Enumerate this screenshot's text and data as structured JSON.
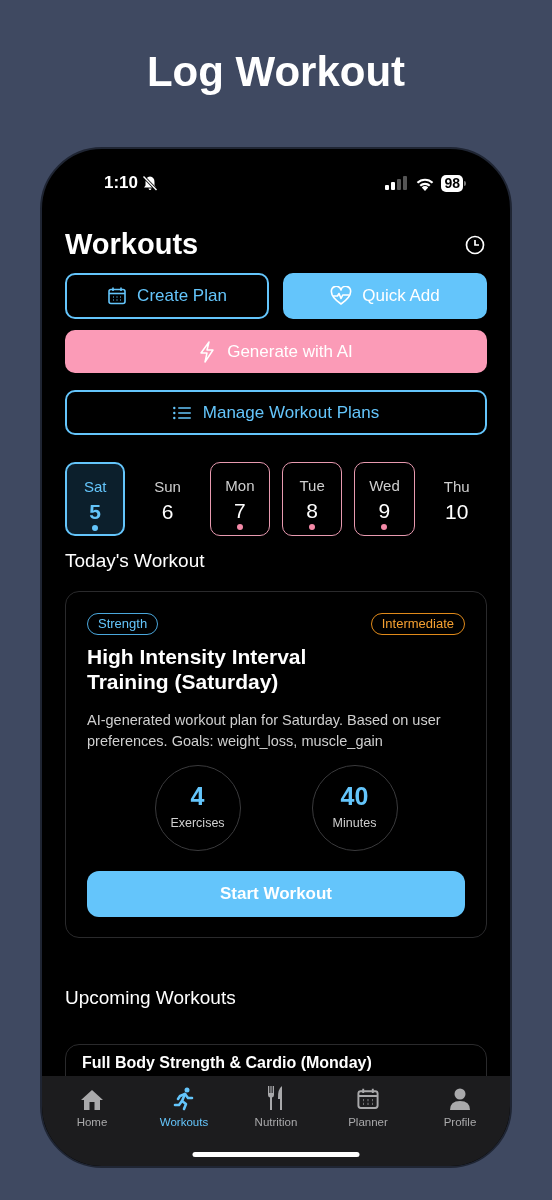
{
  "page_title": "Log Workout",
  "status_bar": {
    "time": "1:10",
    "battery": "98"
  },
  "header": {
    "title": "Workouts"
  },
  "actions": [
    {
      "label": "Create Plan",
      "kind": "outline"
    },
    {
      "label": "Quick Add",
      "kind": "filled"
    }
  ],
  "generate_button": {
    "label": "Generate with AI"
  },
  "manage_button": {
    "label": "Manage Workout Plans"
  },
  "days": [
    {
      "weekday": "Sat",
      "date": "5",
      "selected": true,
      "has_workout": true
    },
    {
      "weekday": "Sun",
      "date": "6",
      "selected": false,
      "has_workout": false
    },
    {
      "weekday": "Mon",
      "date": "7",
      "selected": false,
      "has_workout": true
    },
    {
      "weekday": "Tue",
      "date": "8",
      "selected": false,
      "has_workout": true
    },
    {
      "weekday": "Wed",
      "date": "9",
      "selected": false,
      "has_workout": true
    },
    {
      "weekday": "Thu",
      "date": "10",
      "selected": false,
      "has_workout": false
    }
  ],
  "today": {
    "heading": "Today's Workout",
    "category": "Strength",
    "level_badge": "Intermediate",
    "title": "High Intensity Interval Training (Saturday)",
    "description": "AI-generated workout plan for Saturday. Based on user preferences. Goals: weight_loss, muscle_gain",
    "stats": [
      {
        "value": "4",
        "label": "Exercises"
      },
      {
        "value": "40",
        "label": "Minutes"
      }
    ],
    "start_button": "Start Workout"
  },
  "upcoming": {
    "heading": "Upcoming Workouts",
    "items": [
      {
        "title": "Full Body Strength & Cardio (Monday)"
      }
    ]
  },
  "tab_bar": [
    {
      "label": "Home",
      "selected": false
    },
    {
      "label": "Workouts",
      "selected": true
    },
    {
      "label": "Nutrition",
      "selected": false
    },
    {
      "label": "Planner",
      "selected": false
    },
    {
      "label": "Profile",
      "selected": false
    }
  ]
}
